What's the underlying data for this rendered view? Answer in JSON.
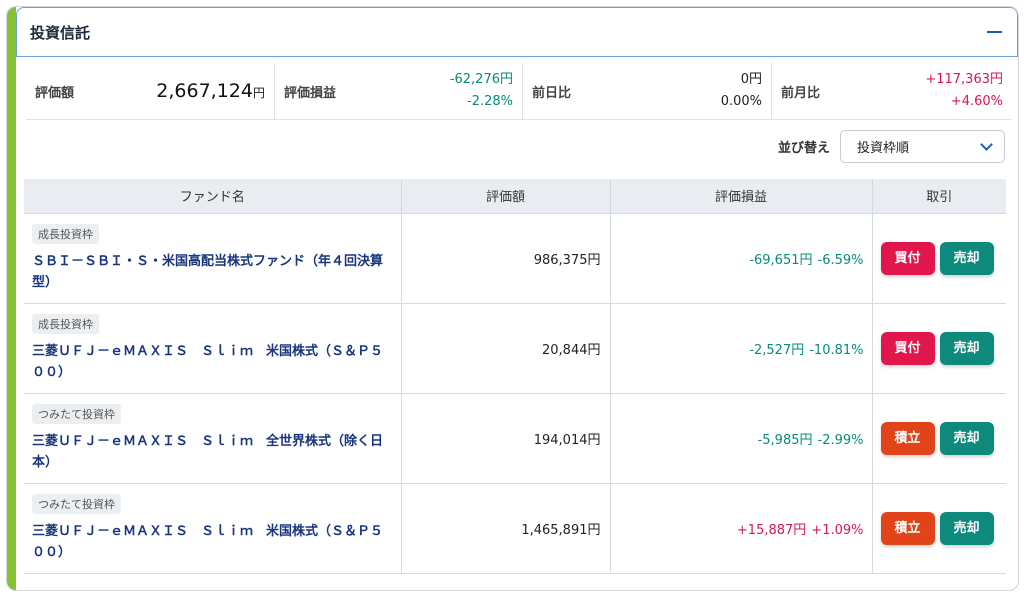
{
  "colors": {
    "accent_bar": "#86c232",
    "negative": "#0a8a78",
    "positive": "#d6194f",
    "buy": "#e0164d",
    "accumulate": "#e04418",
    "sell": "#0d8a7c",
    "link": "#18357d"
  },
  "card": {
    "title": "投資信託",
    "collapse_icon": "minus-icon"
  },
  "summary": {
    "valuation_label": "評価額",
    "valuation_value": "2,667,124",
    "valuation_unit": "円",
    "pl_label": "評価損益",
    "pl_amount": "-62,276円",
    "pl_percent": "-2.28%",
    "daychange_label": "前日比",
    "daychange_amount": "0円",
    "daychange_percent": "0.00%",
    "monthchange_label": "前月比",
    "monthchange_amount": "+117,363円",
    "monthchange_percent": "+4.60%"
  },
  "sort": {
    "label": "並び替え",
    "selected": "投資枠順"
  },
  "table": {
    "headers": [
      "ファンド名",
      "評価額",
      "評価損益",
      "取引"
    ],
    "rows": [
      {
        "badge": "成長投資枠",
        "name": "ＳＢＩ－ＳＢＩ・Ｓ・米国高配当株式ファンド（年４回決算型）",
        "value": "986,375円",
        "pl_amount": "-69,651円",
        "pl_percent": "-6.59%",
        "pl_sign": "neg",
        "action1": "買付",
        "action1_type": "buy",
        "action2": "売却"
      },
      {
        "badge": "成長投資枠",
        "name": "三菱ＵＦＪ－ｅＭＡＸＩＳ　Ｓｌｉｍ　米国株式（Ｓ＆Ｐ５００）",
        "value": "20,844円",
        "pl_amount": "-2,527円",
        "pl_percent": "-10.81%",
        "pl_sign": "neg",
        "action1": "買付",
        "action1_type": "buy",
        "action2": "売却"
      },
      {
        "badge": "つみたて投資枠",
        "name": "三菱ＵＦＪ－ｅＭＡＸＩＳ　Ｓｌｉｍ　全世界株式（除く日本）",
        "value": "194,014円",
        "pl_amount": "-5,985円",
        "pl_percent": "-2.99%",
        "pl_sign": "neg",
        "action1": "積立",
        "action1_type": "tsumi",
        "action2": "売却"
      },
      {
        "badge": "つみたて投資枠",
        "name": "三菱ＵＦＪ－ｅＭＡＸＩＳ　Ｓｌｉｍ　米国株式（Ｓ＆Ｐ５００）",
        "value": "1,465,891円",
        "pl_amount": "+15,887円",
        "pl_percent": "+1.09%",
        "pl_sign": "pos",
        "action1": "積立",
        "action1_type": "tsumi",
        "action2": "売却"
      }
    ]
  }
}
